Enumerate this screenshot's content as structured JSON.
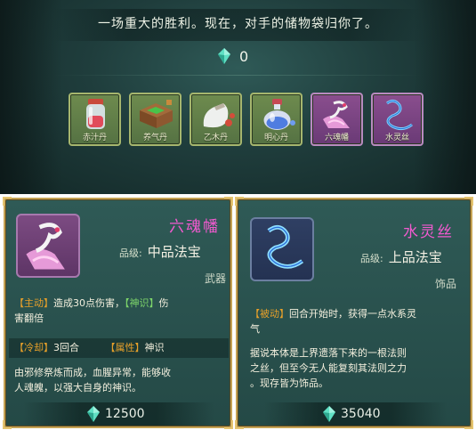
{
  "victory": {
    "message": "一场重大的胜利。现在，对手的储物袋归你了。",
    "currency_count": "0",
    "items": [
      {
        "label": "赤汁丹",
        "icon": "red-elixir-bottle-icon",
        "quality": "green"
      },
      {
        "label": "养气丹",
        "icon": "herb-chest-icon",
        "quality": "green"
      },
      {
        "label": "乙木丹",
        "icon": "pill-pouch-icon",
        "quality": "green"
      },
      {
        "label": "明心丹",
        "icon": "blue-potion-icon",
        "quality": "green"
      },
      {
        "label": "六魂幡",
        "icon": "soul-banner-icon",
        "quality": "purple"
      },
      {
        "label": "水灵丝",
        "icon": "water-silk-icon",
        "quality": "purple"
      }
    ]
  },
  "card_left": {
    "name": "六魂幡",
    "grade_label": "品级:",
    "grade_value": "中品法宝",
    "category": "武器",
    "active_tag": "【主动】",
    "active_text": "造成30点伤害，",
    "sense_tag": "【神识】",
    "active_text2": "伤",
    "active_text3": "害翻倍",
    "cooldown_tag": "【冷却】",
    "cooldown_value": "3回合",
    "attr_tag": "【属性】",
    "attr_value": "神识",
    "desc_line1": "由邪修祭炼而成，血腥异常，能够收",
    "desc_line2": "人魂魄，以强大自身的神识。",
    "price": "12500"
  },
  "card_right": {
    "name": "水灵丝",
    "grade_label": "品级:",
    "grade_value": "上品法宝",
    "category": "饰品",
    "passive_tag": "【被动】",
    "passive_text": "回合开始时，获得一点水系灵",
    "passive_text2": "气",
    "desc_line1": "据说本体是上界遗落下来的一根法则",
    "desc_line2": "之丝，但至今无人能复刻其法则之力",
    "desc_line3": "。现存皆为饰品。",
    "price": "35040"
  },
  "colors": {
    "gem": "#5fe0c4",
    "name": "#f25ad0",
    "tag_orange": "#e7a02a",
    "tag_green": "#7dd56a",
    "border_gold": "#c5a254"
  }
}
